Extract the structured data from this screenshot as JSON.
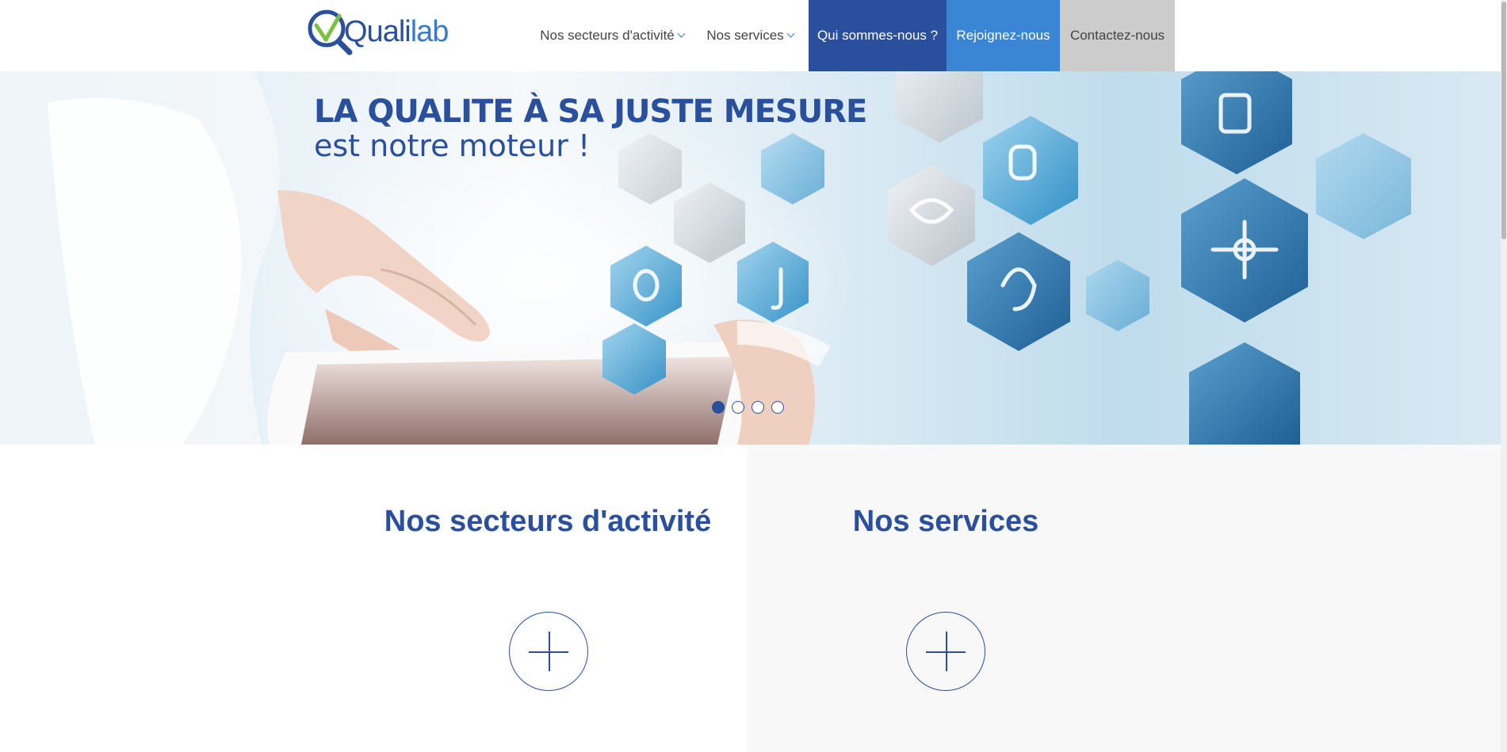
{
  "header": {
    "logo": {
      "text_q": "Quali",
      "text_lab": "lab"
    },
    "nav": [
      {
        "label": "Nos secteurs d'activité",
        "has_dropdown": true
      },
      {
        "label": "Nos services",
        "has_dropdown": true
      },
      {
        "label": "Qui sommes-nous ?",
        "has_dropdown": false
      },
      {
        "label": "Rejoignez-nous",
        "has_dropdown": false
      },
      {
        "label": "Contactez-nous",
        "has_dropdown": false
      }
    ]
  },
  "hero": {
    "title": "LA QUALITE À SA JUSTE MESURE",
    "subtitle": "est notre moteur !",
    "slides_count": 4,
    "active_slide": 1
  },
  "sections": {
    "left": {
      "title": "Nos secteurs d'activité",
      "button_icon": "plus-icon"
    },
    "right": {
      "title": "Nos services",
      "button_icon": "plus-icon"
    }
  },
  "colors": {
    "brand_dark": "#2a4f9c",
    "brand_light": "#3a86d4",
    "gray_tab": "#cccccc",
    "section_alt_bg": "#f8f8f8",
    "logo_check": "#7cc043"
  }
}
